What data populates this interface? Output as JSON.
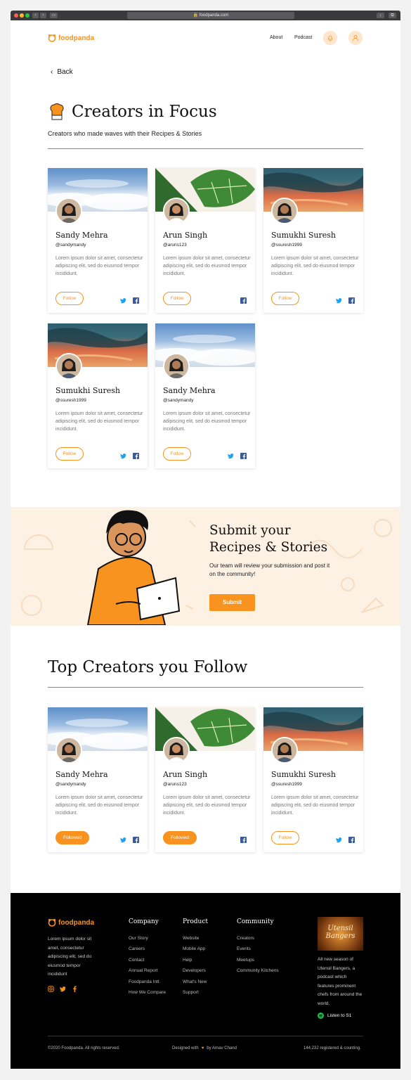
{
  "browser": {
    "url": "foodpanda.com"
  },
  "header": {
    "brand": "foodpanda",
    "nav": [
      "About",
      "Podcast"
    ]
  },
  "back_label": "Back",
  "focus": {
    "title": "Creators in Focus",
    "subtitle": "Creators who made waves with their Recipes & Stories"
  },
  "creators_focus": [
    {
      "name": "Sandy Mehra",
      "handle": "@sandymandy",
      "desc": "Lorem ipsum dolor sit amet, consectetur adipiscing elit, sed do eiusmod tempor incididunt.",
      "button": "Follow",
      "cover": "clouds",
      "twitter": true,
      "facebook": true
    },
    {
      "name": "Arun Singh",
      "handle": "@aruns123",
      "desc": "Lorem ipsum dolor sit amet, consectetur adipiscing elit, sed do eiusmod tempor incididunt.",
      "button": "Follow",
      "cover": "leaves",
      "twitter": false,
      "facebook": true
    },
    {
      "name": "Sumukhi Suresh",
      "handle": "@ssuresh1999",
      "desc": "Lorem ipsum dolor sit amet, consectetur adipiscing elit, sed do eiusmod tempor incididunt.",
      "button": "Follow",
      "cover": "sunset",
      "twitter": true,
      "facebook": true
    },
    {
      "name": "Sumukhi Suresh",
      "handle": "@ssuresh1999",
      "desc": "Lorem ipsum dolor sit amet, consectetur adipiscing elit, sed do eiusmod tempor incididunt.",
      "button": "Follow",
      "cover": "sunset",
      "twitter": true,
      "facebook": true
    },
    {
      "name": "Sandy Mehra",
      "handle": "@sandymandy",
      "desc": "Lorem ipsum dolor sit amet, consectetur adipiscing elit, sed do eiusmod tempor incididunt.",
      "button": "Follow",
      "cover": "clouds",
      "twitter": true,
      "facebook": true
    }
  ],
  "submit": {
    "title_line1": "Submit your",
    "title_line2": "Recipes & Stories",
    "text": "Our team will review your submission and post it on the community!",
    "button": "Submit"
  },
  "following": {
    "title": "Top Creators you Follow"
  },
  "creators_following": [
    {
      "name": "Sandy Mehra",
      "handle": "@sandymandy",
      "desc": "Lorem ipsum dolor sit amet, consectetur adipiscing elit, sed do eiusmod tempor incididunt.",
      "button": "Followed",
      "cover": "clouds",
      "twitter": true,
      "facebook": true
    },
    {
      "name": "Arun Singh",
      "handle": "@aruns123",
      "desc": "Lorem ipsum dolor sit amet, consectetur adipiscing elit, sed do eiusmod tempor incididunt.",
      "button": "Followed",
      "cover": "leaves",
      "twitter": false,
      "facebook": true
    },
    {
      "name": "Sumukhi Suresh",
      "handle": "@ssuresh1999",
      "desc": "Lorem ipsum dolor sit amet, consectetur adipiscing elit, sed do eiusmod tempor incididunt.",
      "button": "Follow",
      "cover": "sunset",
      "twitter": true,
      "facebook": true
    }
  ],
  "footer": {
    "brand": "foodpanda",
    "about": "Lorem ipsum dolor sit amet, consectetur adipiscing elit, sed do eiusmod tempor incididunt",
    "company": {
      "title": "Company",
      "items": [
        "Our Story",
        "Careers",
        "Contact",
        "Annual Report",
        "Foodpanda Intl.",
        "How We Compare"
      ]
    },
    "product": {
      "title": "Product",
      "items": [
        "Website",
        "Mobile App",
        "Help",
        "Developers",
        "What's New",
        "Support"
      ]
    },
    "community": {
      "title": "Community",
      "items": [
        "Creators",
        "Events",
        "Meetups",
        "Community Kitchens"
      ]
    },
    "podcast": {
      "cover_text": "Utensil Bangers",
      "desc": "All new season of Utensil Bangers, a podcast which features prominent chefs from around the world.",
      "listen": "Listen to S1"
    },
    "copyright": "©2020 Foodpanda. All rights reserved.",
    "designed_prefix": "Designed with",
    "designed_suffix": "by Arnav Chand",
    "stats": "144,232 registered & counting."
  },
  "colors": {
    "brand": "#f7931e",
    "banner_bg": "#fdf1e4",
    "footer_bg": "#000000",
    "twitter": "#1da1f2",
    "facebook": "#3b5998"
  }
}
